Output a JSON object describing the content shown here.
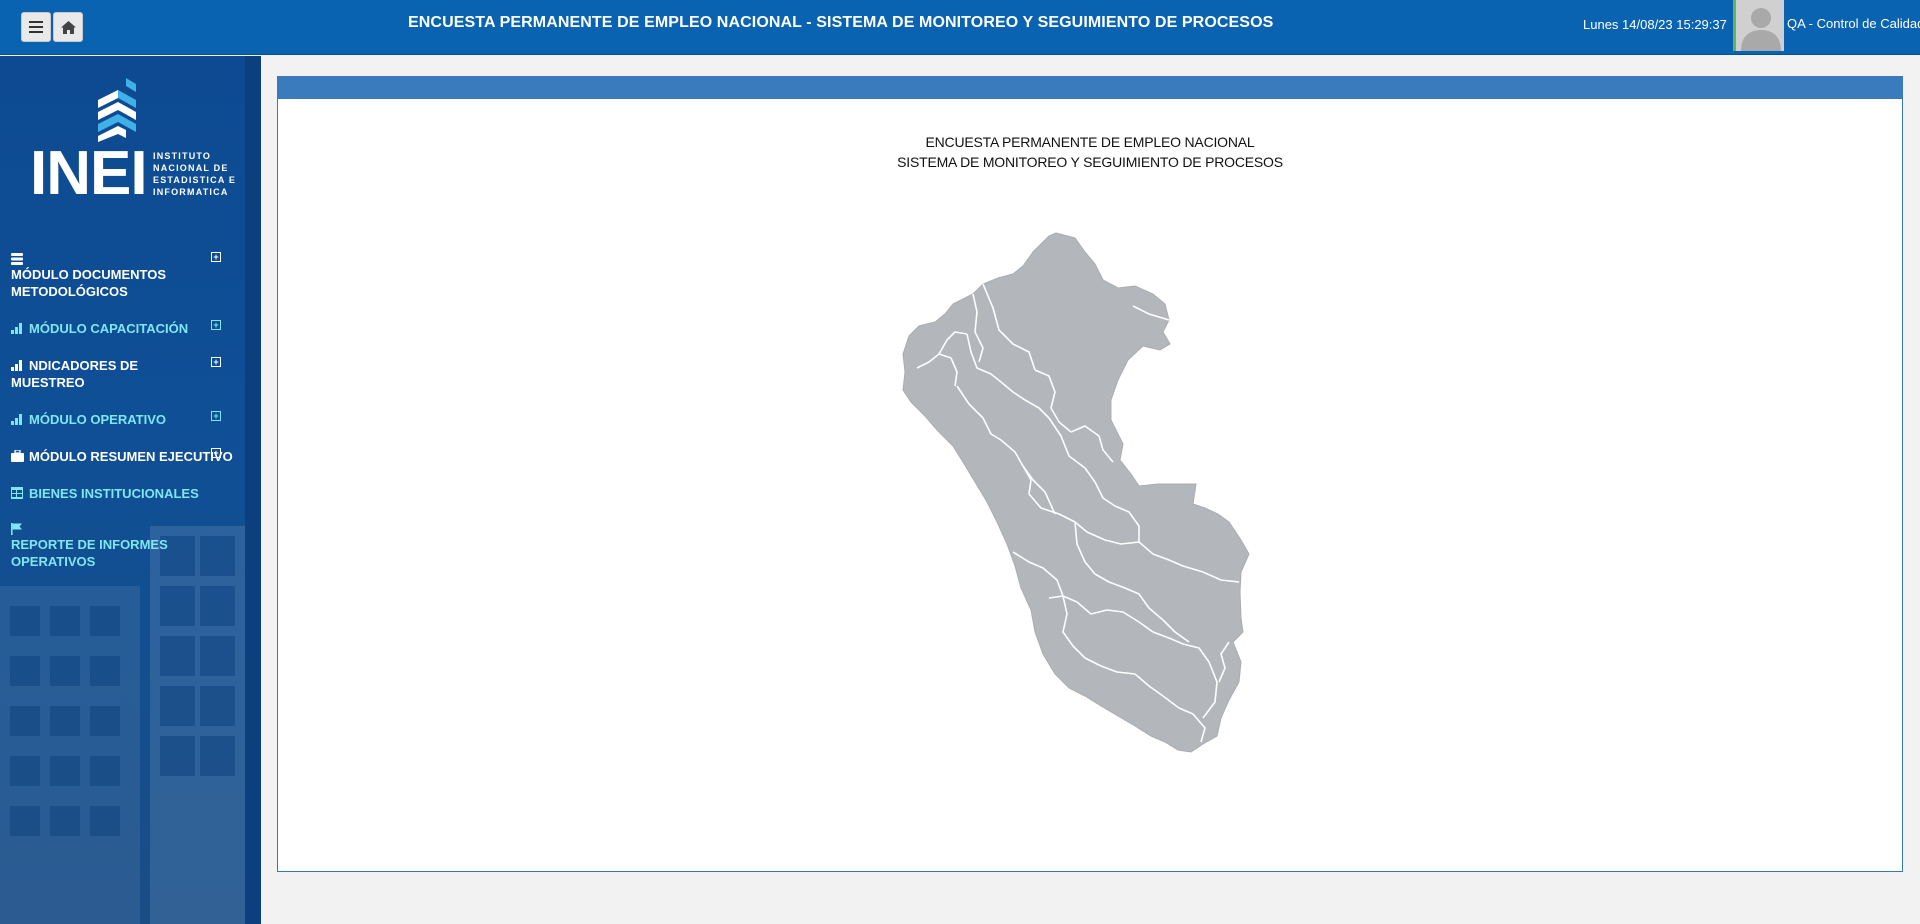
{
  "header": {
    "title": "ENCUESTA PERMANENTE DE EMPLEO NACIONAL - SISTEMA DE MONITOREO Y SEGUIMIENTO DE PROCESOS",
    "datetime": "Lunes 14/08/23 15:29:37",
    "user": "QA - Control de Calidad",
    "menu_icon": "hamburger-icon",
    "home_icon": "home-icon"
  },
  "logo": {
    "name": "INEI",
    "sub_lines": [
      "INSTITUTO",
      "NACIONAL DE",
      "ESTADISTICA E",
      "INFORMATICA"
    ]
  },
  "sidebar": {
    "items": [
      {
        "label": "MÓDULO DOCUMENTOS METODOLÓGICOS",
        "icon": "database-icon",
        "color": "#ffffff",
        "expandable": true
      },
      {
        "label": "MÓDULO CAPACITACIÓN",
        "icon": "bar-chart-icon",
        "color": "#7fe6f2",
        "expandable": true
      },
      {
        "label": "NDICADORES DE MUESTREO",
        "icon": "bar-chart-icon",
        "color": "#ffffff",
        "expandable": true
      },
      {
        "label": "MÓDULO OPERATIVO",
        "icon": "bar-chart-icon",
        "color": "#7fe6f2",
        "expandable": true
      },
      {
        "label": "MÓDULO RESUMEN EJECUTIVO",
        "icon": "briefcase-icon",
        "color": "#ffffff",
        "expandable": true
      },
      {
        "label": "BIENES INSTITUCIONALES",
        "icon": "table-icon",
        "color": "#7fe6f2",
        "expandable": false
      },
      {
        "label": "REPORTE DE INFORMES OPERATIVOS",
        "icon": "flag-icon",
        "color": "#7fe6f2",
        "expandable": false
      }
    ]
  },
  "main": {
    "title_line1": "ENCUESTA PERMANENTE DE EMPLEO NACIONAL",
    "title_line2": "SISTEMA DE MONITOREO Y SEGUIMIENTO DE PROCESOS",
    "map_icon": "peru-map"
  },
  "colors": {
    "topbar": "#0a63b0",
    "panel_header": "#3a7bbd",
    "map_fill": "#b3b6bb",
    "accent_cyan": "#7fe6f2"
  }
}
